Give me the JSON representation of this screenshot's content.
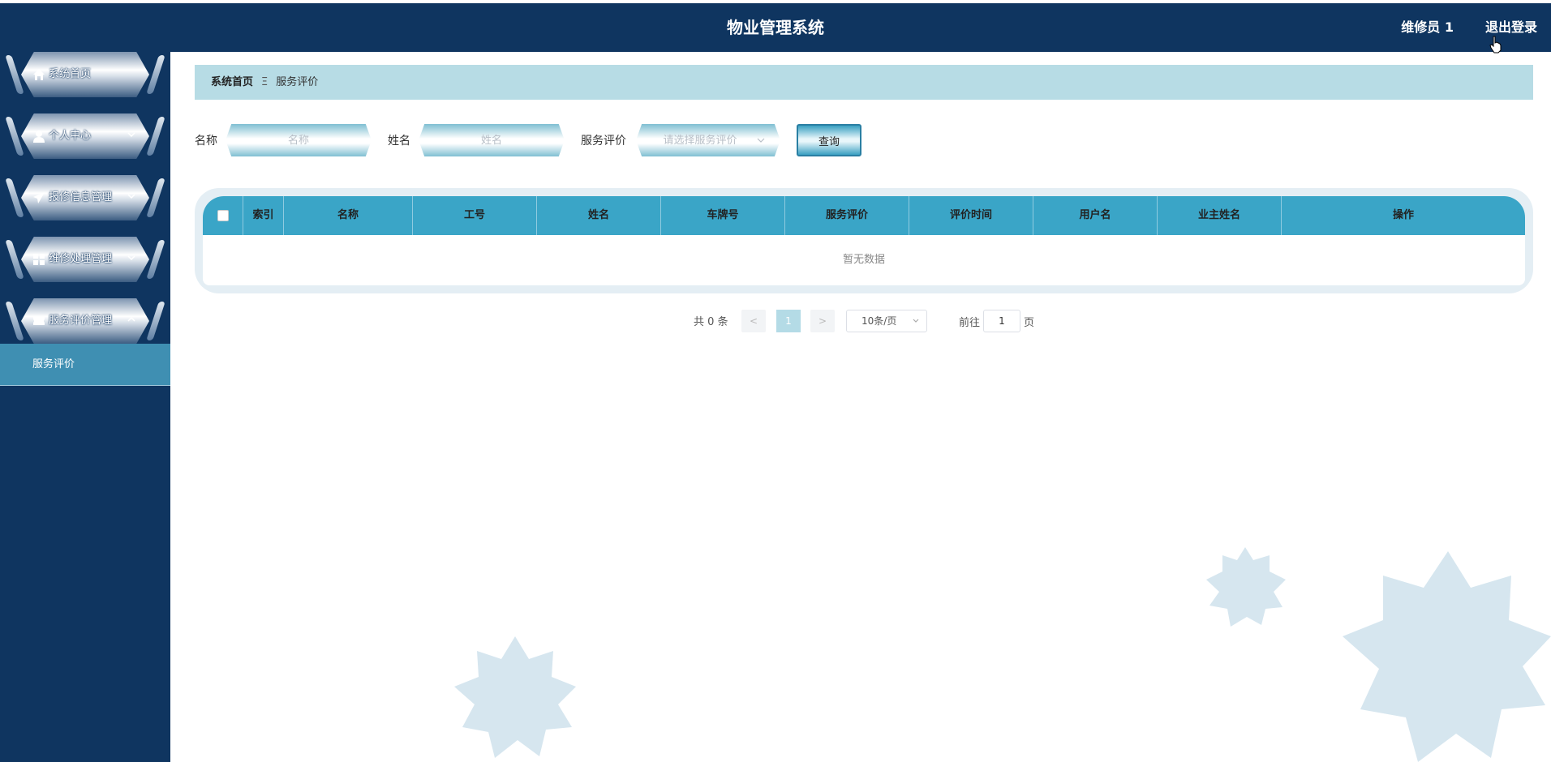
{
  "header": {
    "title": "物业管理系统",
    "user": "维修员 1",
    "logout": "退出登录"
  },
  "sidebar": {
    "items": [
      {
        "label": "系统首页",
        "icon": "home-icon"
      },
      {
        "label": "个人中心",
        "icon": "user-icon"
      },
      {
        "label": "报修信息管理",
        "icon": "send-icon"
      },
      {
        "label": "维修处理管理",
        "icon": "grid-icon"
      },
      {
        "label": "服务评价管理",
        "icon": "ticket-icon"
      }
    ],
    "submenu": "服务评价"
  },
  "breadcrumb": {
    "home": "系统首页",
    "separator": "Ξ",
    "current": "服务评价"
  },
  "search": {
    "name_label": "名称",
    "name_placeholder": "名称",
    "person_label": "姓名",
    "person_placeholder": "姓名",
    "rating_label": "服务评价",
    "rating_placeholder": "请选择服务评价",
    "query_button": "查询"
  },
  "table": {
    "columns": [
      "索引",
      "名称",
      "工号",
      "姓名",
      "车牌号",
      "服务评价",
      "评价时间",
      "用户名",
      "业主姓名",
      "操作"
    ],
    "empty_text": "暂无数据"
  },
  "pagination": {
    "total": "共 0 条",
    "prev": "<",
    "page": "1",
    "next": ">",
    "page_size": "10条/页",
    "goto": "前往",
    "goto_value": "1",
    "unit": "页"
  },
  "colors": {
    "navy": "#0f3560",
    "accent": "#3aa5c7",
    "breadcrumb_bg": "#b7dce5"
  }
}
